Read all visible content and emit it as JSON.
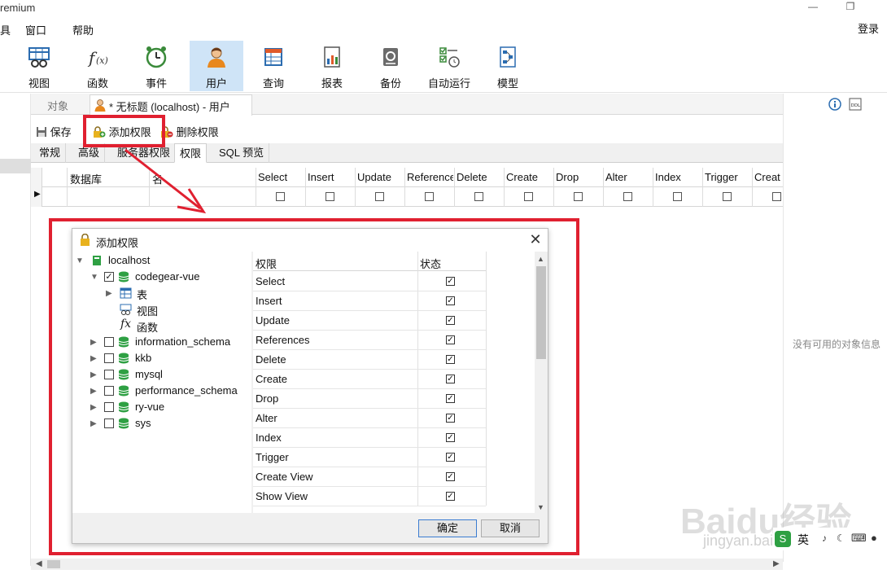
{
  "window": {
    "title": "remium"
  },
  "menu": {
    "items": [
      "具",
      "窗口",
      "帮助"
    ],
    "login": "登录"
  },
  "toolbar": {
    "tools": [
      {
        "label": "视图",
        "icon": "view-icon"
      },
      {
        "label": "函数",
        "icon": "function-icon"
      },
      {
        "label": "事件",
        "icon": "event-clock-icon"
      },
      {
        "label": "用户",
        "icon": "user-icon",
        "active": true
      },
      {
        "label": "查询",
        "icon": "query-icon"
      },
      {
        "label": "报表",
        "icon": "report-icon"
      },
      {
        "label": "备份",
        "icon": "backup-icon"
      },
      {
        "label": "自动运行",
        "icon": "autorun-icon"
      },
      {
        "label": "模型",
        "icon": "model-icon"
      }
    ]
  },
  "tabs": {
    "objects": "对象",
    "document": "* 无标题 (localhost) - 用户"
  },
  "actions": {
    "save": "保存",
    "add_priv": "添加权限",
    "delete_priv": "删除权限"
  },
  "subtabs": [
    "常规",
    "高级",
    "服务器权限",
    "权限",
    "SQL 预览"
  ],
  "grid": {
    "headers": [
      "数据库",
      "名",
      "Select",
      "Insert",
      "Update",
      "References",
      "Delete",
      "Create",
      "Drop",
      "Alter",
      "Index",
      "Trigger",
      "Creat"
    ]
  },
  "right_panel": {
    "message": "没有可用的对象信息"
  },
  "dialog": {
    "title": "添加权限",
    "tree": {
      "root": "localhost",
      "db_selected": "codegear-vue",
      "children": [
        "表",
        "视图",
        "函数"
      ],
      "other_dbs": [
        "information_schema",
        "kkb",
        "mysql",
        "performance_schema",
        "ry-vue",
        "sys"
      ]
    },
    "columns": {
      "privilege": "权限",
      "status": "状态"
    },
    "privileges": [
      "Select",
      "Insert",
      "Update",
      "References",
      "Delete",
      "Create",
      "Drop",
      "Alter",
      "Index",
      "Trigger",
      "Create View",
      "Show View"
    ],
    "ok": "确定",
    "cancel": "取消"
  },
  "watermark": {
    "main": "Baidu经验",
    "sub": "jingyan.baidu.com"
  },
  "ime": {
    "lang": "英"
  },
  "colors": {
    "annotation_red": "#e02030",
    "active_tool": "#cfe4f7",
    "db_green": "#2ea043"
  }
}
